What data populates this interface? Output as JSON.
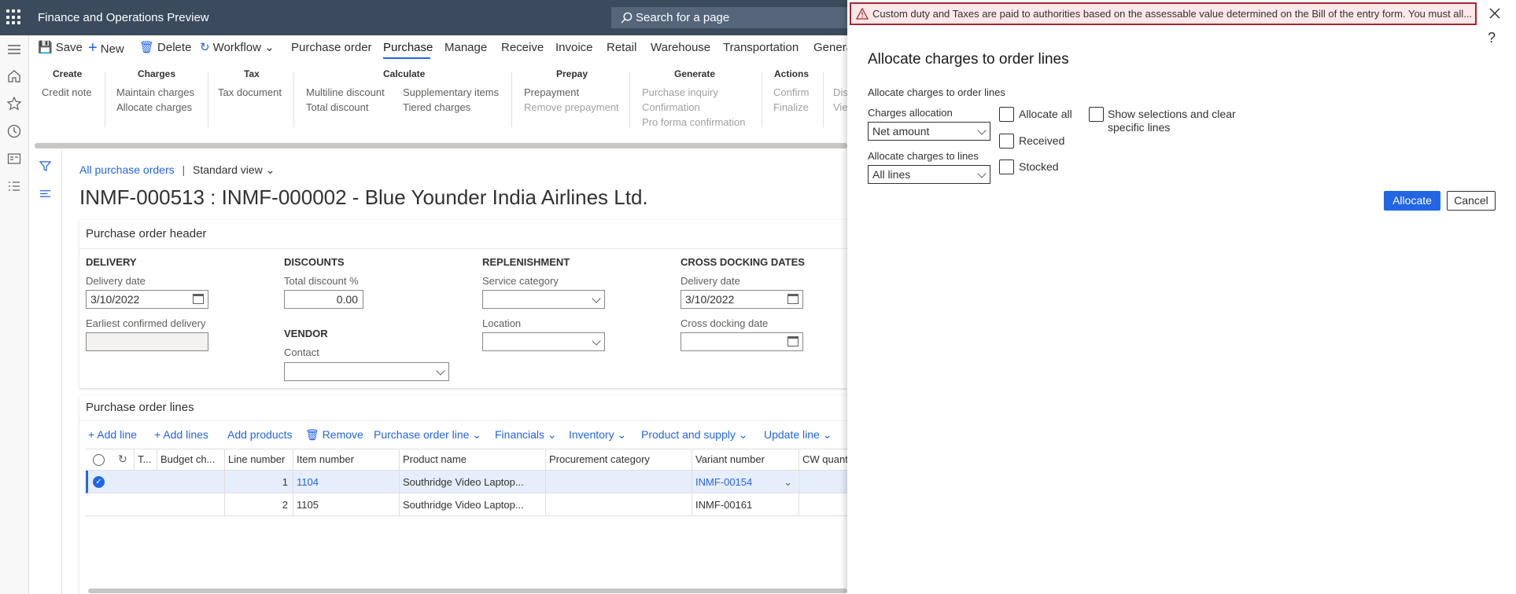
{
  "header": {
    "app_title": "Finance and Operations Preview",
    "search_placeholder": "Search for a page"
  },
  "actions": {
    "save": "Save",
    "new": "New",
    "delete": "Delete",
    "workflow": "Workflow",
    "tabs": [
      "Purchase order",
      "Purchase",
      "Manage",
      "Receive",
      "Invoice",
      "Retail",
      "Warehouse",
      "Transportation",
      "Genera"
    ]
  },
  "ribbon": {
    "create": {
      "title": "Create",
      "items": [
        "Credit note"
      ]
    },
    "charges": {
      "title": "Charges",
      "items": [
        "Maintain charges",
        "Allocate charges"
      ]
    },
    "tax": {
      "title": "Tax",
      "items": [
        "Tax document"
      ]
    },
    "calculate": {
      "title": "Calculate",
      "items": [
        "Multiline discount",
        "Total discount",
        "Supplementary items",
        "Tiered charges"
      ]
    },
    "prepay": {
      "title": "Prepay",
      "items": [
        "Prepayment",
        "Remove prepayment"
      ]
    },
    "generate": {
      "title": "Generate",
      "items": [
        "Purchase inquiry",
        "Confirmation",
        "Pro forma confirmation"
      ]
    },
    "actions": {
      "title": "Actions",
      "items": [
        "Confirm",
        "Finalize"
      ]
    },
    "cut": {
      "items": [
        "Dis",
        "Vie"
      ]
    }
  },
  "page": {
    "breadcrumb": "All purchase orders",
    "view": "Standard view",
    "title": "INMF-000513 : INMF-000002 - Blue Younder India Airlines Ltd."
  },
  "po_header": {
    "title": "Purchase order header",
    "delivery": {
      "section": "DELIVERY",
      "delivery_date_label": "Delivery date",
      "delivery_date": "3/10/2022",
      "earliest_label": "Earliest confirmed delivery",
      "earliest": ""
    },
    "discounts": {
      "section": "DISCOUNTS",
      "total_discount_label": "Total discount %",
      "total_discount": "0.00"
    },
    "vendor": {
      "section": "VENDOR",
      "contact_label": "Contact",
      "contact": ""
    },
    "replenishment": {
      "section": "REPLENISHMENT",
      "service_category_label": "Service category",
      "location_label": "Location"
    },
    "cross_docking": {
      "section": "CROSS DOCKING DATES",
      "delivery_date_label": "Delivery date",
      "delivery_date": "3/10/2022",
      "cross_docking_label": "Cross docking date"
    }
  },
  "po_lines": {
    "title": "Purchase order lines",
    "toolbar": [
      "Add line",
      "Add lines",
      "Add products",
      "Remove",
      "Purchase order line",
      "Financials",
      "Inventory",
      "Product and supply",
      "Update line"
    ],
    "columns": [
      "T...",
      "Budget ch...",
      "Line number",
      "Item number",
      "Product name",
      "Procurement category",
      "Variant number",
      "CW quant"
    ],
    "rows": [
      {
        "line": "1",
        "item": "1104",
        "product": "Southridge Video Laptop...",
        "category": "",
        "variant": "INMF-00154"
      },
      {
        "line": "2",
        "item": "1105",
        "product": "Southridge Video Laptop...",
        "category": "",
        "variant": "INMF-00161"
      }
    ]
  },
  "message": "Custom duty and Taxes are paid to authorities based on the assessable value determined on the Bill of the entry form. You must all...",
  "dialog": {
    "title": "Allocate charges to order lines",
    "group_label": "Allocate charges to order lines",
    "charges_allocation_label": "Charges allocation",
    "charges_allocation": "Net amount",
    "allocate_to_lines_label": "Allocate charges to lines",
    "allocate_to_lines": "All lines",
    "allocate_all": "Allocate all",
    "received": "Received",
    "stocked": "Stocked",
    "show_selections": "Show selections and clear specific lines",
    "allocate_button": "Allocate",
    "cancel_button": "Cancel",
    "help": "?"
  },
  "colors": {
    "accent": "#2266e3",
    "topbar": "#3b4a5c",
    "error": "#a4262c"
  }
}
